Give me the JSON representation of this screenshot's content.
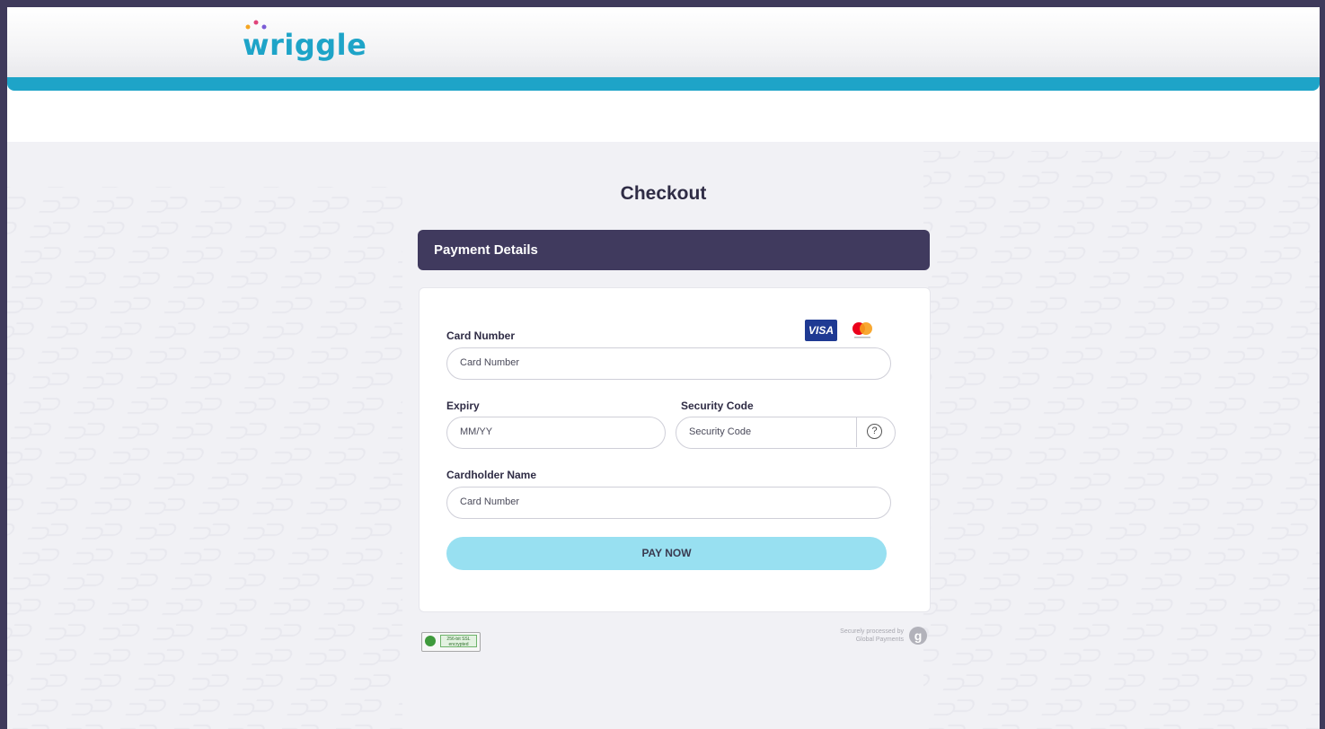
{
  "header": {
    "logo_text": "wriggle",
    "brand_color": "#1ea4c8"
  },
  "page": {
    "title": "Checkout"
  },
  "payment": {
    "section_title": "Payment Details",
    "card_number_label": "Card Number",
    "card_number_placeholder": "Card Number",
    "expiry_label": "Expiry",
    "expiry_placeholder": "MM/YY",
    "security_label": "Security Code",
    "security_placeholder": "Security Code",
    "security_help": "?",
    "cardholder_label": "Cardholder Name",
    "cardholder_placeholder": "Card Number",
    "pay_button": "PAY NOW",
    "card_brands": [
      "VISA",
      "mastercard"
    ]
  },
  "footer": {
    "ssl_badge_text": "256-bit SSL encrypted",
    "processed_line1": "Securely processed by",
    "processed_line2": "Global Payments",
    "processor_logo_icon": "global-payments-logo-icon"
  },
  "colors": {
    "outer_bg": "#3f3a5b",
    "panel_header": "#403a5e",
    "pay_button_bg": "#98e0f1",
    "main_bg": "#f1f1f5"
  }
}
